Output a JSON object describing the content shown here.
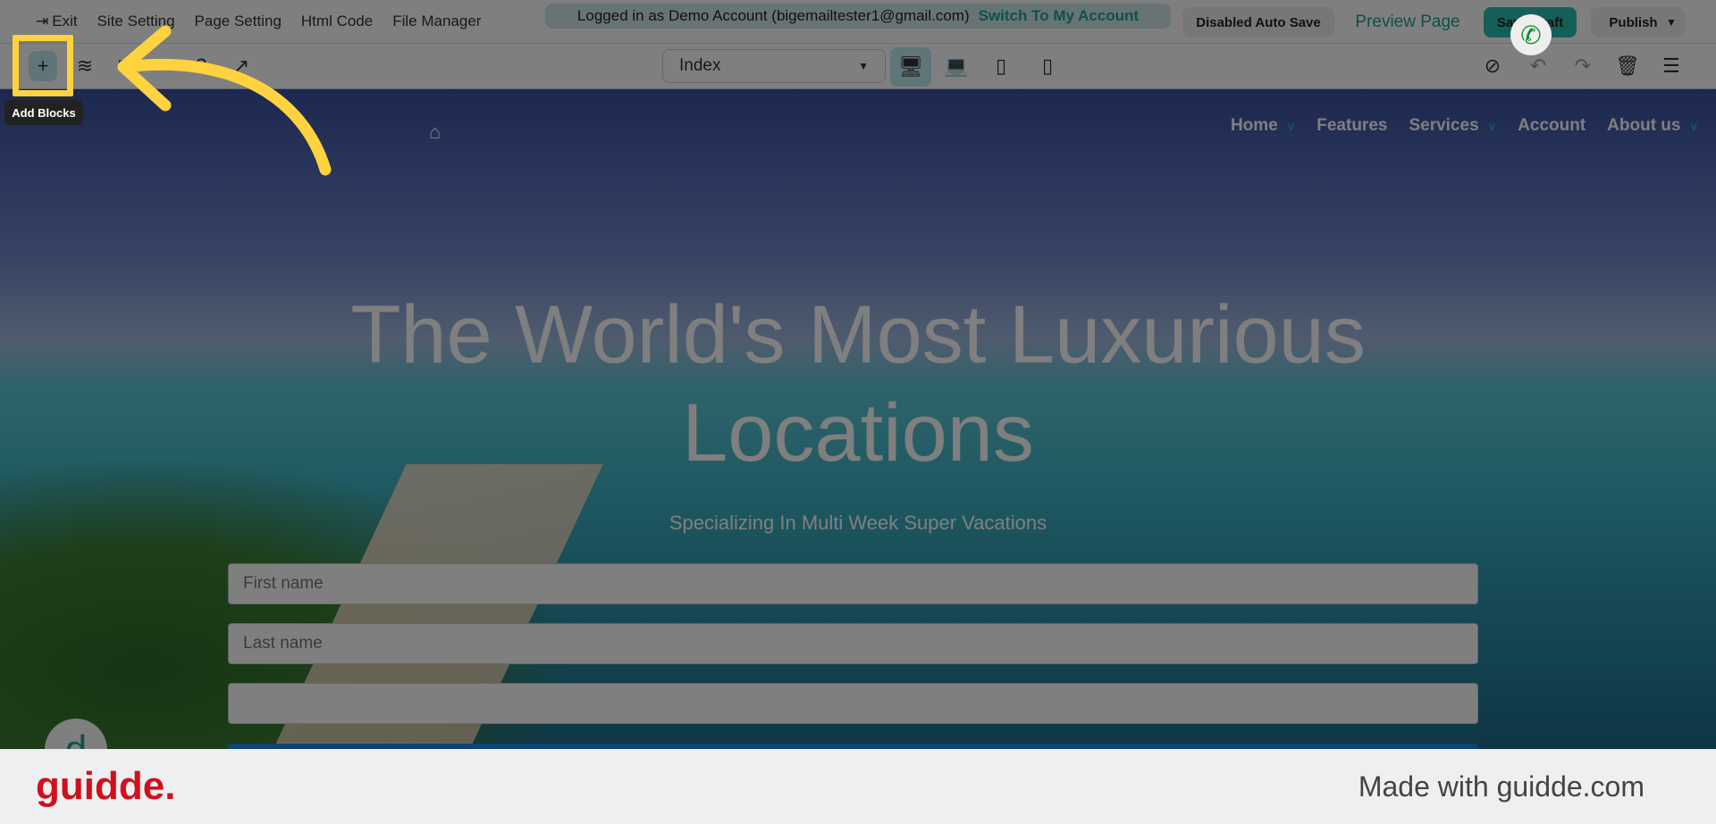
{
  "topbar": {
    "exit": "Exit",
    "site_setting": "Site Setting",
    "page_setting": "Page Setting",
    "html_code": "Html Code",
    "file_manager": "File Manager",
    "login_text": "Logged in as Demo Account (bigemailtester1@gmail.com)",
    "switch_account": "Switch To My Account",
    "auto_save": "Disabled Auto Save",
    "preview": "Preview Page",
    "save_draft": "Save Draft",
    "publish": "Publish"
  },
  "toolbar": {
    "page_select": "Index",
    "tooltip": "Add Blocks"
  },
  "site": {
    "nav": [
      "Home",
      "Features",
      "Services",
      "Account",
      "About us"
    ],
    "headline1": "The World's Most Luxurious",
    "headline2": "Locations",
    "subtitle": "Specializing In Multi Week Super Vacations",
    "first_name": "First name",
    "last_name": "Last name"
  },
  "footer": {
    "logo": "guidde.",
    "made_with": "Made with guidde.com"
  },
  "colors": {
    "accent": "#1aa39a",
    "highlight": "#ffd23f",
    "brand": "#d1101c"
  }
}
